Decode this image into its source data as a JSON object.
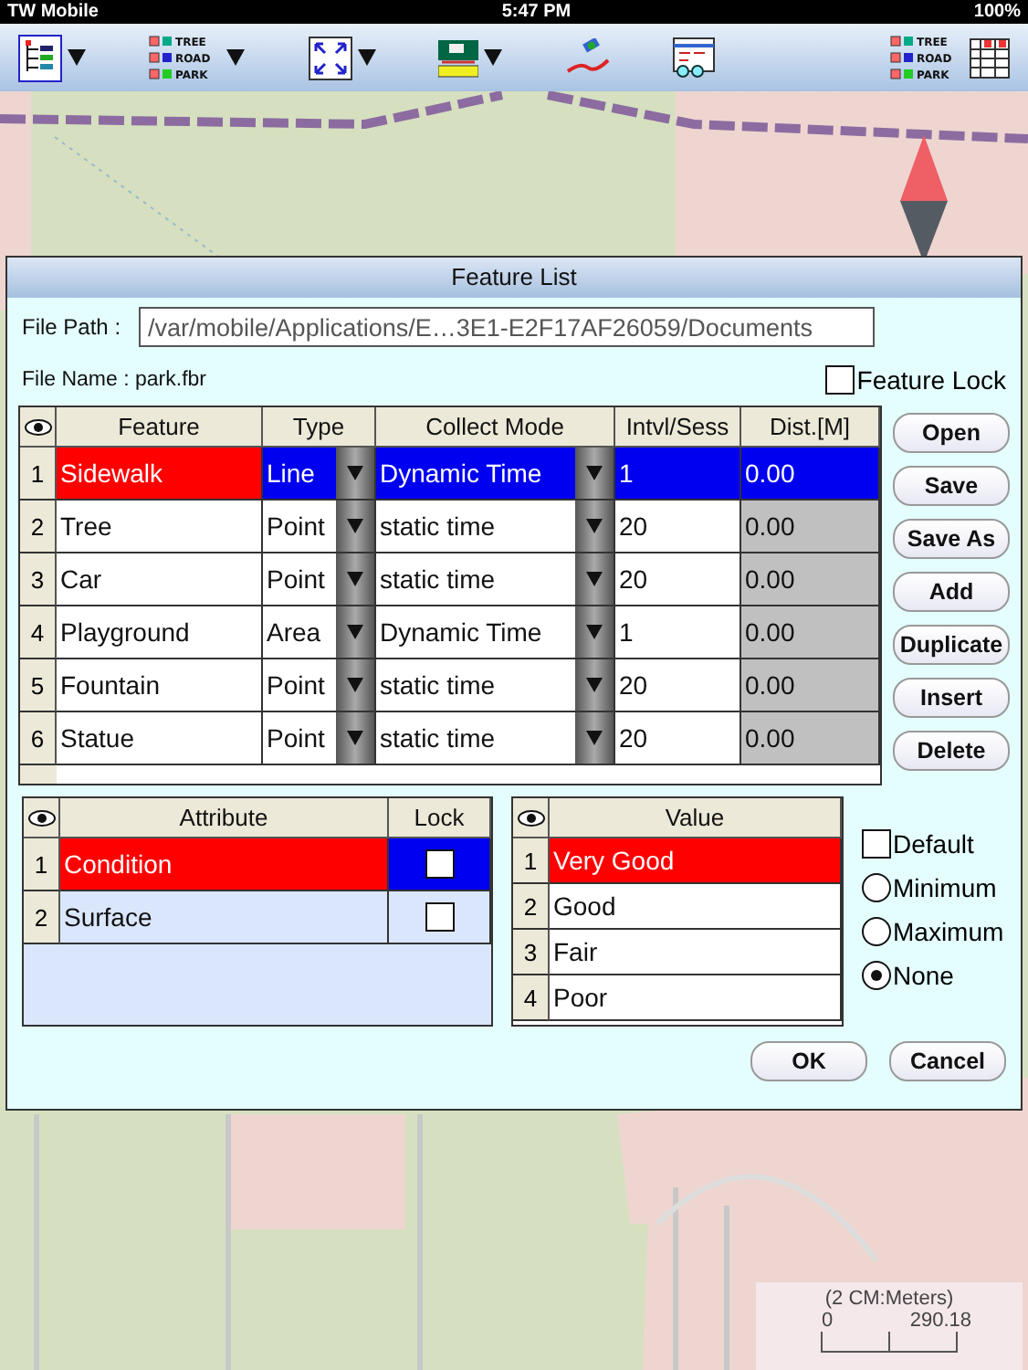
{
  "status_bar": {
    "carrier": "TW Mobile",
    "time": "5:47 PM",
    "battery": "100%"
  },
  "toolbar": {
    "legend_labels": [
      "TREE",
      "ROAD",
      "PARK"
    ],
    "legend_labels_right": [
      "TREE",
      "ROAD",
      "PARK"
    ]
  },
  "scale_bar": {
    "caption": "(2 CM:Meters)",
    "start": "0",
    "end": "290.18"
  },
  "dialog": {
    "title": "Feature List",
    "file_path_label": "File Path :",
    "file_path": "/var/mobile/Applications/E…3E1-E2F17AF26059/Documents",
    "file_name_label": "File Name :",
    "file_name": "park.fbr",
    "feature_lock": {
      "label": "Feature Lock",
      "checked": false
    },
    "feature_table": {
      "columns": [
        "Feature",
        "Type",
        "Collect Mode",
        "Intvl/Sess",
        "Dist.[M]"
      ],
      "rows": [
        {
          "num": "1",
          "feature": "Sidewalk",
          "type": "Line",
          "mode": "Dynamic Time",
          "interval": "1",
          "dist": "0.00",
          "selected": true
        },
        {
          "num": "2",
          "feature": "Tree",
          "type": "Point",
          "mode": "static time",
          "interval": "20",
          "dist": "0.00",
          "selected": false
        },
        {
          "num": "3",
          "feature": "Car",
          "type": "Point",
          "mode": "static time",
          "interval": "20",
          "dist": "0.00",
          "selected": false
        },
        {
          "num": "4",
          "feature": "Playground",
          "type": "Area",
          "mode": "Dynamic Time",
          "interval": "1",
          "dist": "0.00",
          "selected": false
        },
        {
          "num": "5",
          "feature": "Fountain",
          "type": "Point",
          "mode": "static time",
          "interval": "20",
          "dist": "0.00",
          "selected": false
        },
        {
          "num": "6",
          "feature": "Statue",
          "type": "Point",
          "mode": "static time",
          "interval": "20",
          "dist": "0.00",
          "selected": false
        }
      ]
    },
    "side_buttons": [
      "Open",
      "Save",
      "Save As",
      "Add",
      "Duplicate",
      "Insert",
      "Delete"
    ],
    "attribute_table": {
      "columns": [
        "Attribute",
        "Lock"
      ],
      "rows": [
        {
          "num": "1",
          "name": "Condition",
          "locked": false,
          "selected": true
        },
        {
          "num": "2",
          "name": "Surface",
          "locked": false,
          "selected": false
        }
      ]
    },
    "value_table": {
      "columns": [
        "Value"
      ],
      "rows": [
        {
          "num": "1",
          "value": "Very Good",
          "selected": true
        },
        {
          "num": "2",
          "value": "Good",
          "selected": false
        },
        {
          "num": "3",
          "value": "Fair",
          "selected": false
        },
        {
          "num": "4",
          "value": "Poor",
          "selected": false
        }
      ]
    },
    "options": [
      {
        "kind": "checkbox",
        "label": "Default",
        "selected": false
      },
      {
        "kind": "radio",
        "label": "Minimum",
        "selected": false
      },
      {
        "kind": "radio",
        "label": "Maximum",
        "selected": false
      },
      {
        "kind": "radio",
        "label": "None",
        "selected": true
      }
    ],
    "buttons": [
      "OK",
      "Cancel"
    ]
  }
}
